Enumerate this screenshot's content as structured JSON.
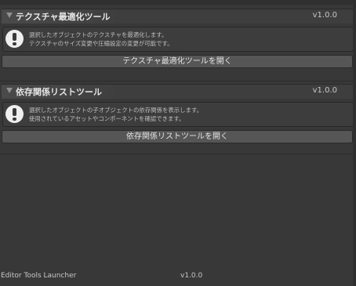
{
  "sections": [
    {
      "title": "テクスチャ最適化ツール",
      "version": "v1.0.0",
      "help_line1": "選択したオブジェクトのテクスチャを最適化します。",
      "help_line2": "テクスチャのサイズ変更や圧縮設定の変更が可能です。",
      "button_label": "テクスチャ最適化ツールを開く"
    },
    {
      "title": "依存関係リストツール",
      "version": "v1.0.0",
      "help_line1": "選択したオブジェクトの子オブジェクトの依存関係を表示します。",
      "help_line2": "使用されているアセットやコンポーネントを確認できます。",
      "button_label": "依存関係リストツールを開く"
    }
  ],
  "footer": {
    "name": "Editor Tools Launcher",
    "version": "v1.0.0"
  },
  "icons": {
    "foldout": "triangle-down-icon",
    "info": "exclamation-info-icon"
  },
  "colors": {
    "window_bg": "#383838",
    "header_bg": "#3e3e3e",
    "button_bg": "#565656",
    "text": "#c8c8c8"
  }
}
